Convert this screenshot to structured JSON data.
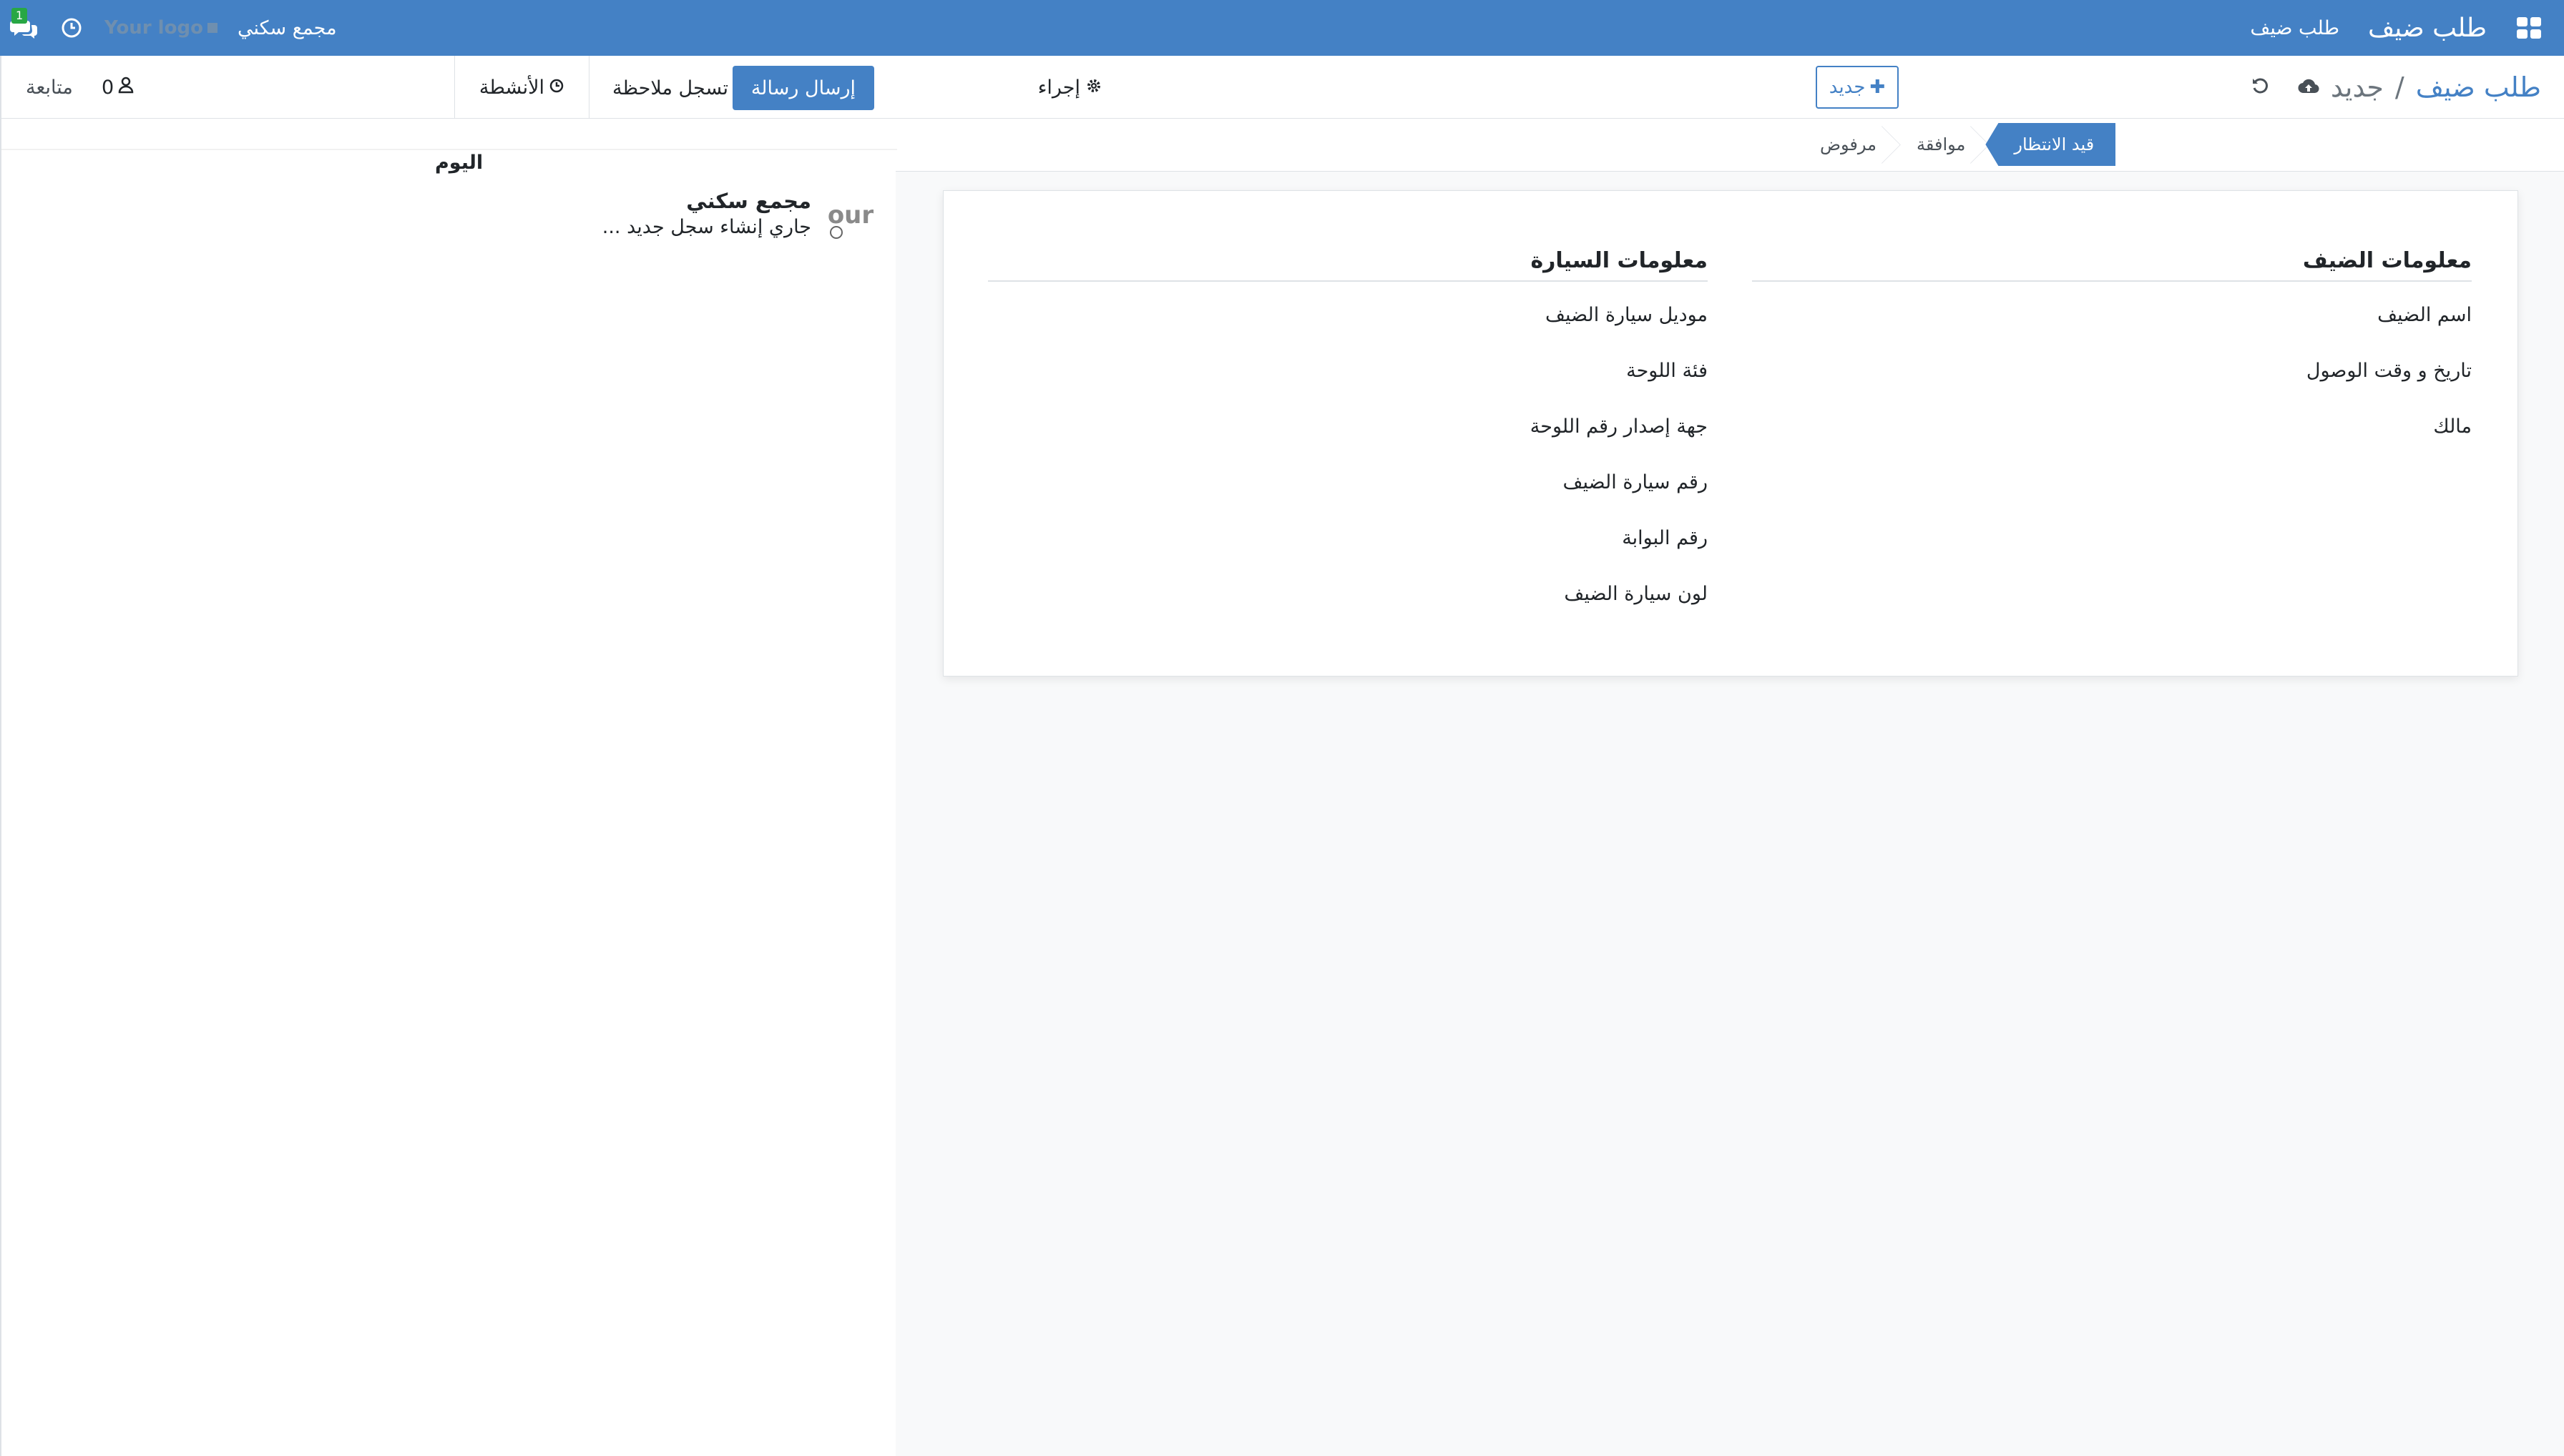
{
  "navbar": {
    "app_name": "طلب ضيف",
    "menu_item": "طلب ضيف",
    "company": "مجمع سكني",
    "logo_text": "Your logo",
    "messages_badge": "1"
  },
  "breadcrumb": {
    "parent": "طلب ضيف",
    "separator": "/",
    "current": "جديد"
  },
  "control_panel": {
    "action_label": "إجراء",
    "new_label": "جديد"
  },
  "statusbar": {
    "stages": [
      {
        "label": "مرفوض",
        "active": false
      },
      {
        "label": "موافقة",
        "active": false
      },
      {
        "label": "قيد الانتظار",
        "active": true
      }
    ]
  },
  "form": {
    "guest_group": {
      "title": "معلومات الضيف",
      "fields": [
        "اسم الضيف",
        "تاريخ و وقت الوصول",
        "مالك"
      ]
    },
    "car_group": {
      "title": "معلومات السيارة",
      "fields": [
        "موديل سيارة الضيف",
        "فئة اللوحة",
        "جهة إصدار رقم اللوحة",
        "رقم سيارة الضيف",
        "رقم البوابة",
        "لون سيارة الضيف"
      ]
    }
  },
  "chatter": {
    "send_message": "إرسال رسالة",
    "log_note": "تسجل ملاحظة",
    "activities": "الأنشطة",
    "followers_count": "0",
    "follow": "متابعة",
    "date_label": "اليوم",
    "message": {
      "author": "مجمع سكني",
      "text": "جاري إنشاء سجل جديد ...",
      "avatar_text": "our"
    }
  },
  "colors": {
    "primary": "#4481c5",
    "badge": "#28a745"
  }
}
